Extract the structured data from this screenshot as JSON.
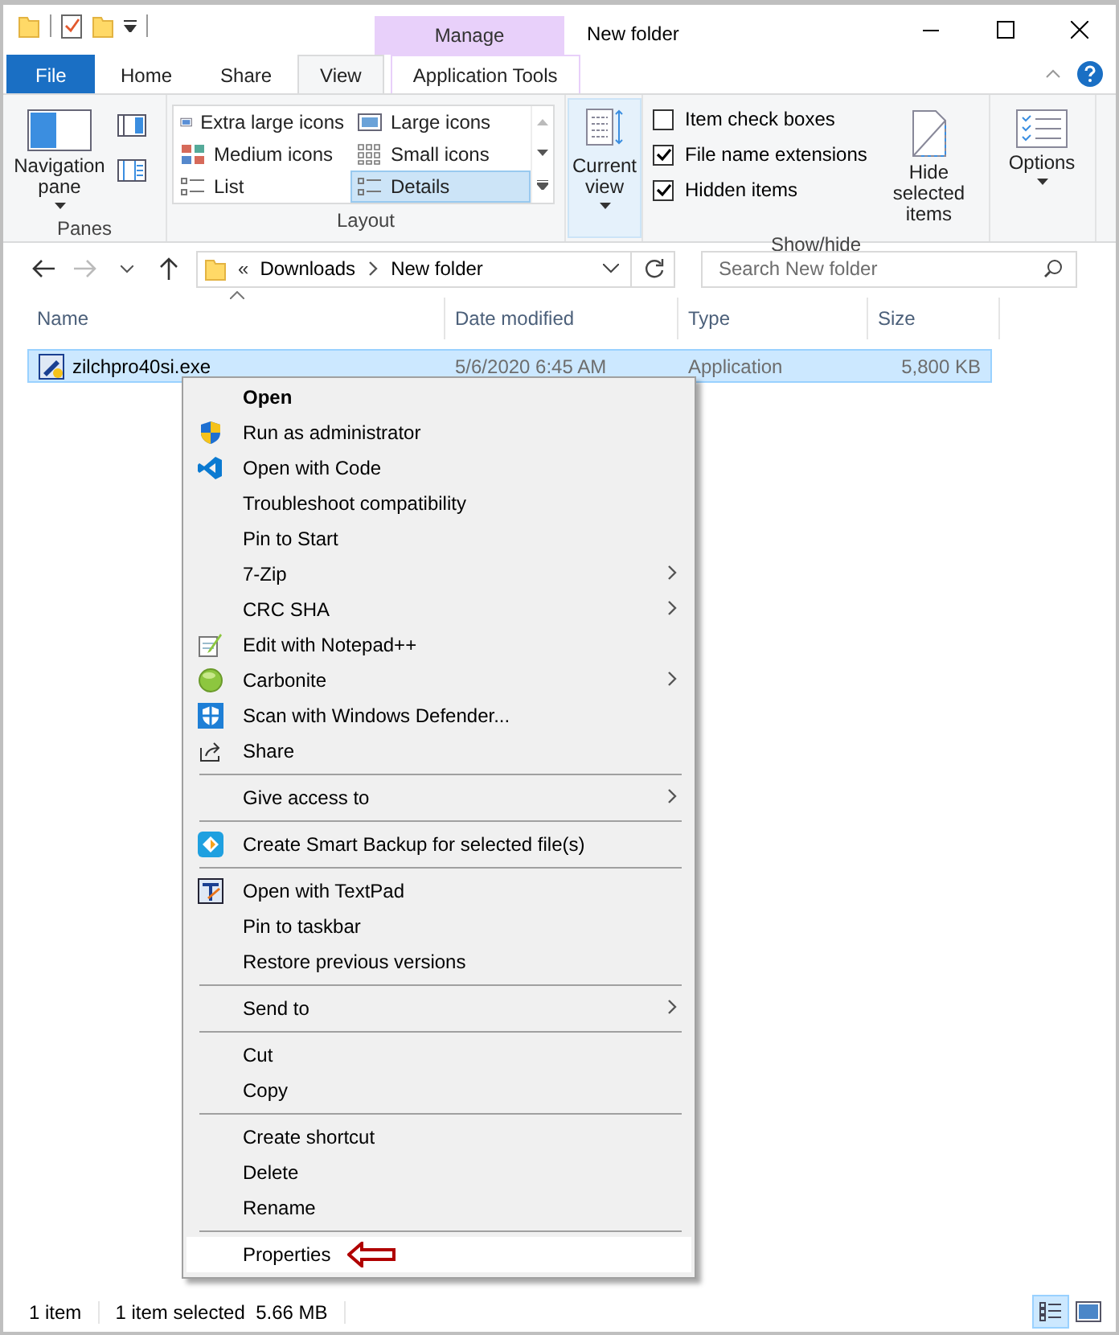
{
  "window": {
    "title": "New folder",
    "context_tab": "Manage"
  },
  "tabs": [
    {
      "label": "File",
      "kind": "file",
      "selected": false
    },
    {
      "label": "Home",
      "kind": "plain",
      "selected": false
    },
    {
      "label": "Share",
      "kind": "plain",
      "selected": false
    },
    {
      "label": "View",
      "kind": "plain",
      "selected": true
    },
    {
      "label": "Application Tools",
      "kind": "context",
      "selected": false
    }
  ],
  "ribbon": {
    "panes": {
      "title": "Panes",
      "navigation_pane": "Navigation pane"
    },
    "layout": {
      "title": "Layout",
      "options": [
        {
          "label": "Extra large icons",
          "kind": "xl",
          "selected": false
        },
        {
          "label": "Large icons",
          "kind": "large",
          "selected": false
        },
        {
          "label": "Medium icons",
          "kind": "medium",
          "selected": false
        },
        {
          "label": "Small icons",
          "kind": "small",
          "selected": false
        },
        {
          "label": "List",
          "kind": "list",
          "selected": false
        },
        {
          "label": "Details",
          "kind": "details",
          "selected": true
        }
      ]
    },
    "current_view": {
      "label": "Current view"
    },
    "show_hide": {
      "title": "Show/hide",
      "checkboxes": [
        {
          "label": "Item check boxes",
          "checked": false
        },
        {
          "label": "File name extensions",
          "checked": true
        },
        {
          "label": "Hidden items",
          "checked": true
        }
      ],
      "hide_selected": "Hide selected items"
    },
    "options": {
      "label": "Options"
    }
  },
  "address": {
    "overflow": "«",
    "crumbs": [
      "Downloads",
      "New folder"
    ],
    "search_placeholder": "Search New folder"
  },
  "columns": [
    "Name",
    "Date modified",
    "Type",
    "Size"
  ],
  "files": [
    {
      "name": "zilchpro40si.exe",
      "date": "5/6/2020 6:45 AM",
      "type": "Application",
      "size": "5,800 KB",
      "selected": true
    }
  ],
  "context_menu": [
    {
      "kind": "plain",
      "label": "Open",
      "default": true,
      "submenu": false,
      "selected": false
    },
    {
      "kind": "shield",
      "label": "Run as administrator",
      "default": false,
      "submenu": false,
      "selected": false
    },
    {
      "kind": "code",
      "label": "Open with Code",
      "default": false,
      "submenu": false,
      "selected": false
    },
    {
      "kind": "plain",
      "label": "Troubleshoot compatibility",
      "default": false,
      "submenu": false,
      "selected": false
    },
    {
      "kind": "plain",
      "label": "Pin to Start",
      "default": false,
      "submenu": false,
      "selected": false
    },
    {
      "kind": "plain",
      "label": "7-Zip",
      "default": false,
      "submenu": true,
      "selected": false
    },
    {
      "kind": "plain",
      "label": "CRC SHA",
      "default": false,
      "submenu": true,
      "selected": false
    },
    {
      "kind": "notepad",
      "label": "Edit with Notepad++",
      "default": false,
      "submenu": false,
      "selected": false
    },
    {
      "kind": "ball",
      "label": "Carbonite",
      "default": false,
      "submenu": true,
      "selected": false
    },
    {
      "kind": "defender",
      "label": "Scan with Windows Defender...",
      "default": false,
      "submenu": false,
      "selected": false
    },
    {
      "kind": "share",
      "label": "Share",
      "default": false,
      "submenu": false,
      "selected": false
    },
    {
      "kind": "separator"
    },
    {
      "kind": "plain",
      "label": "Give access to",
      "default": false,
      "submenu": true,
      "selected": false
    },
    {
      "kind": "separator"
    },
    {
      "kind": "backup",
      "label": "Create Smart Backup for selected file(s)",
      "default": false,
      "submenu": false,
      "selected": false
    },
    {
      "kind": "separator"
    },
    {
      "kind": "textpad",
      "label": "Open with TextPad",
      "default": false,
      "submenu": false,
      "selected": false
    },
    {
      "kind": "plain",
      "label": "Pin to taskbar",
      "default": false,
      "submenu": false,
      "selected": false
    },
    {
      "kind": "plain",
      "label": "Restore previous versions",
      "default": false,
      "submenu": false,
      "selected": false
    },
    {
      "kind": "separator"
    },
    {
      "kind": "plain",
      "label": "Send to",
      "default": false,
      "submenu": true,
      "selected": false
    },
    {
      "kind": "separator"
    },
    {
      "kind": "plain",
      "label": "Cut",
      "default": false,
      "submenu": false,
      "selected": false
    },
    {
      "kind": "plain",
      "label": "Copy",
      "default": false,
      "submenu": false,
      "selected": false
    },
    {
      "kind": "separator"
    },
    {
      "kind": "plain",
      "label": "Create shortcut",
      "default": false,
      "submenu": false,
      "selected": false
    },
    {
      "kind": "plain",
      "label": "Delete",
      "default": false,
      "submenu": false,
      "selected": false
    },
    {
      "kind": "plain",
      "label": "Rename",
      "default": false,
      "submenu": false,
      "selected": false
    },
    {
      "kind": "separator"
    },
    {
      "kind": "plain",
      "label": "Properties",
      "default": false,
      "submenu": false,
      "selected": true
    }
  ],
  "status_bar": {
    "count": "1 item",
    "selection": "1 item selected  5.66 MB",
    "views": [
      {
        "kind": "details",
        "selected": true
      },
      {
        "kind": "thumbnails",
        "selected": false
      }
    ]
  }
}
